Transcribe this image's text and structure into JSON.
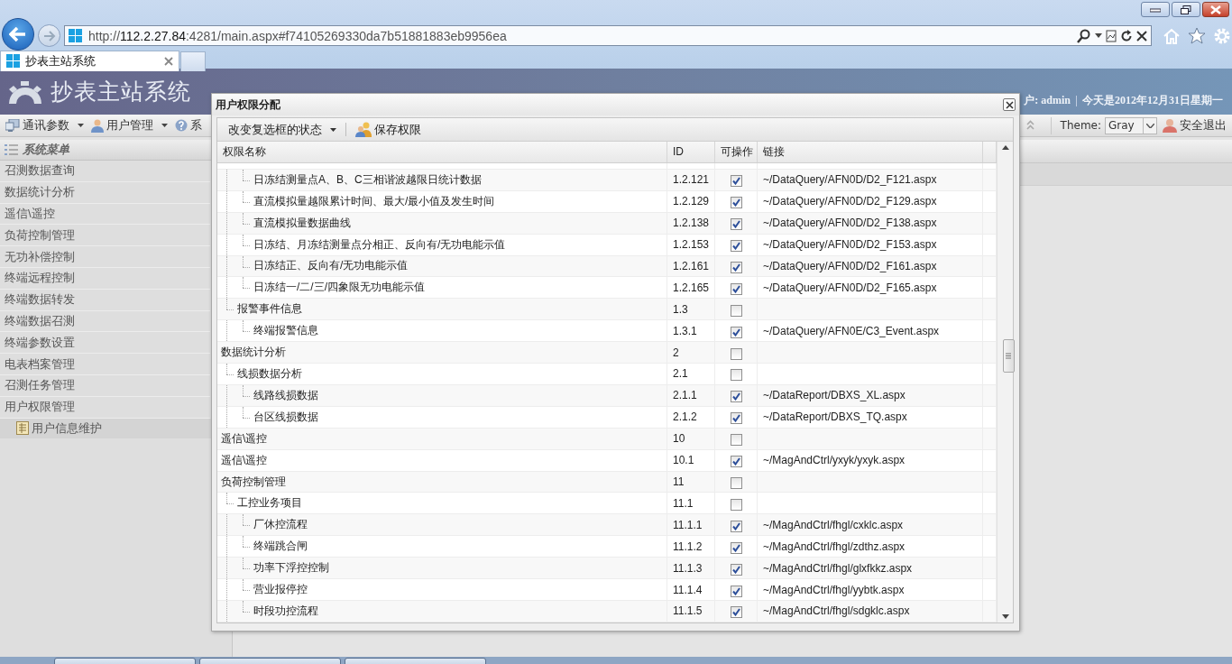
{
  "browser": {
    "url": "http://**112.2.27.84**:4281/main.aspx#f74105269330da7b51881883eb9956ea",
    "tab_title": "抄表主站系统"
  },
  "app": {
    "title": "抄表主站系统",
    "user": "户: admin",
    "date": "今天是2012年12月31日星期一"
  },
  "toolbar": {
    "menus": [
      {
        "label": "通讯参数",
        "kind": "dropdown"
      },
      {
        "label": "用户管理",
        "kind": "dropdown"
      },
      {
        "label": "系",
        "kind": "plain"
      }
    ],
    "theme_label": "Theme:",
    "theme_value": "Gray",
    "logout": "安全退出"
  },
  "sidebar": {
    "title": "系统菜单",
    "items": [
      {
        "label": "召测数据查询"
      },
      {
        "label": "数据统计分析"
      },
      {
        "label": "遥信\\遥控"
      },
      {
        "label": "负荷控制管理"
      },
      {
        "label": "无功补偿控制"
      },
      {
        "label": "终端远程控制"
      },
      {
        "label": "终端数据转发"
      },
      {
        "label": "终端数据召测"
      },
      {
        "label": "终端参数设置"
      },
      {
        "label": "电表档案管理"
      },
      {
        "label": "召测任务管理"
      },
      {
        "label": "用户权限管理",
        "children": [
          {
            "label": "用户信息维护"
          }
        ]
      }
    ]
  },
  "dialog": {
    "title": "用户权限分配",
    "toolbar": [
      {
        "label": "改变复选框的状态",
        "kind": "dropdown"
      },
      {
        "label": "保存权限",
        "kind": "button"
      }
    ],
    "columns": [
      "权限名称",
      "ID",
      "可操作",
      "链接"
    ],
    "rows": [
      {
        "children": [
          {
            "children": [
              {
                "name": "日冻结测量点A、B、C三相谐波越限日统计数据",
                "id": "1.2.121",
                "checked": true,
                "link": "~/DataQuery/AFN0D/D2_F121.aspx"
              },
              {
                "name": "直流模拟量越限累计时间、最大/最小值及发生时间",
                "id": "1.2.129",
                "checked": true,
                "link": "~/DataQuery/AFN0D/D2_F129.aspx"
              },
              {
                "name": "直流模拟量数据曲线",
                "id": "1.2.138",
                "checked": true,
                "link": "~/DataQuery/AFN0D/D2_F138.aspx"
              },
              {
                "name": "日冻结、月冻结测量点分相正、反向有/无功电能示值",
                "id": "1.2.153",
                "checked": true,
                "link": "~/DataQuery/AFN0D/D2_F153.aspx"
              },
              {
                "name": "日冻结正、反向有/无功电能示值",
                "id": "1.2.161",
                "checked": true,
                "link": "~/DataQuery/AFN0D/D2_F161.aspx"
              },
              {
                "name": "日冻结一/二/三/四象限无功电能示值",
                "id": "1.2.165",
                "checked": true,
                "link": "~/DataQuery/AFN0D/D2_F165.aspx"
              }
            ]
          },
          {
            "name": "报警事件信息",
            "id": "1.3",
            "checked": false,
            "children": [
              {
                "name": "终端报警信息",
                "id": "1.3.1",
                "checked": true,
                "link": "~/DataQuery/AFN0E/C3_Event.aspx"
              }
            ]
          }
        ]
      },
      {
        "name": "数据统计分析",
        "id": "2",
        "checked": false,
        "children": [
          {
            "name": "线损数据分析",
            "id": "2.1",
            "checked": false,
            "children": [
              {
                "name": "线路线损数据",
                "id": "2.1.1",
                "checked": true,
                "link": "~/DataReport/DBXS_XL.aspx"
              },
              {
                "name": "台区线损数据",
                "id": "2.1.2",
                "checked": true,
                "link": "~/DataReport/DBXS_TQ.aspx"
              }
            ]
          }
        ]
      },
      {
        "name": "遥信\\遥控",
        "id": "10",
        "checked": false
      },
      {
        "name": "遥信\\遥控",
        "id": "10.1",
        "checked": true,
        "link": "~/MagAndCtrl/yxyk/yxyk.aspx"
      },
      {
        "name": "负荷控制管理",
        "id": "11",
        "checked": false,
        "children": [
          {
            "name": "工控业务项目",
            "id": "11.1",
            "checked": false,
            "children": [
              {
                "name": "厂休控流程",
                "id": "11.1.1",
                "checked": true,
                "link": "~/MagAndCtrl/fhgl/cxklc.aspx"
              },
              {
                "name": "终端跳合闸",
                "id": "11.1.2",
                "checked": true,
                "link": "~/MagAndCtrl/fhgl/zdthz.aspx"
              },
              {
                "name": "功率下浮控控制",
                "id": "11.1.3",
                "checked": true,
                "link": "~/MagAndCtrl/fhgl/glxfkkz.aspx"
              },
              {
                "name": "营业报停控",
                "id": "11.1.4",
                "checked": true,
                "link": "~/MagAndCtrl/fhgl/yybtk.aspx"
              },
              {
                "name": "时段功控流程",
                "id": "11.1.5",
                "checked": true,
                "link": "~/MagAndCtrl/fhgl/sdgklc.aspx"
              }
            ]
          }
        ]
      }
    ]
  }
}
